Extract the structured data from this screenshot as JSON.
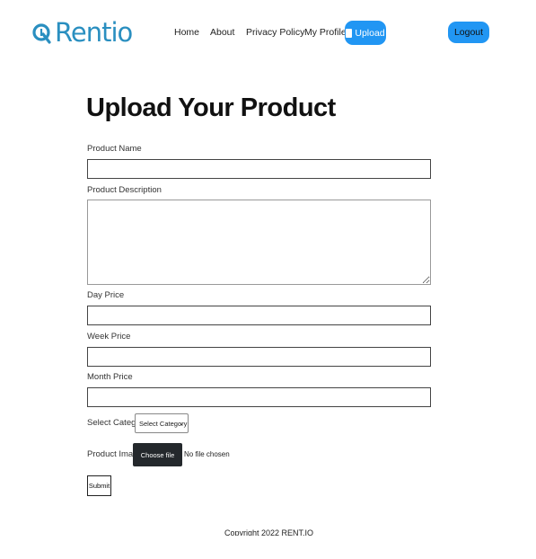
{
  "brand": {
    "name": "Rentio",
    "logo_icon": "rentio-logo-icon",
    "color": "#2a8fc0"
  },
  "nav": {
    "items": [
      "Home",
      "About",
      "Privacy Policy",
      "My Profile"
    ],
    "upload": "Upload",
    "logout": "Logout",
    "accent": "#2196f3"
  },
  "page": {
    "title": "Upload Your Product"
  },
  "form": {
    "product_name": {
      "label": "Product Name",
      "value": ""
    },
    "product_description": {
      "label": "Product Description",
      "value": ""
    },
    "day_price": {
      "label": "Day Price",
      "value": ""
    },
    "week_price": {
      "label": "Week Price",
      "value": ""
    },
    "month_price": {
      "label": "Month Price",
      "value": ""
    },
    "category": {
      "label": "Select Category",
      "selected": "Select Category"
    },
    "image": {
      "label": "Product Image",
      "button": "Choose file",
      "status": "No file chosen"
    },
    "submit": "Submit"
  },
  "footer": {
    "text": "Copyright 2022 RENT.IO"
  }
}
